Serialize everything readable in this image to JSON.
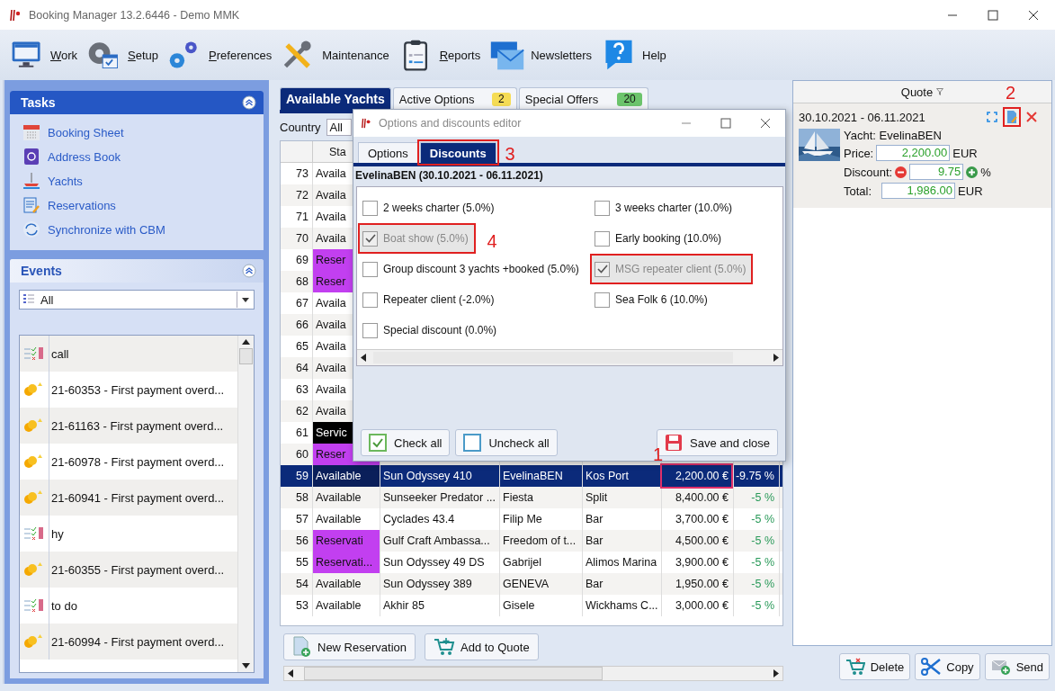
{
  "window": {
    "title": "Booking Manager 13.2.6446 - Demo MMK"
  },
  "toolbar": [
    {
      "label": "Work",
      "access_key": true
    },
    {
      "label": "Setup",
      "access_key": true
    },
    {
      "label": "Preferences",
      "access_key": true
    },
    {
      "label": "Maintenance",
      "access_key": false
    },
    {
      "label": "Reports",
      "access_key": true
    },
    {
      "label": "Newsletters",
      "access_key": false
    },
    {
      "label": "Help",
      "access_key": false
    }
  ],
  "tasks": {
    "title": "Tasks",
    "items": [
      "Booking Sheet",
      "Address Book",
      "Yachts",
      "Reservations",
      "Synchronize with CBM"
    ]
  },
  "events": {
    "title": "Events",
    "filter": "All",
    "items": [
      {
        "kind": "task",
        "text": "call"
      },
      {
        "kind": "payment",
        "text": "21-60353 - First payment overd..."
      },
      {
        "kind": "payment",
        "text": "21-61163 - First payment overd..."
      },
      {
        "kind": "payment",
        "text": "21-60978 - First payment overd..."
      },
      {
        "kind": "payment",
        "text": "21-60941 - First payment overd..."
      },
      {
        "kind": "task",
        "text": "hy"
      },
      {
        "kind": "payment",
        "text": "21-60355 - First payment overd..."
      },
      {
        "kind": "task",
        "text": "to do"
      },
      {
        "kind": "payment",
        "text": "21-60994 - First payment overd..."
      }
    ]
  },
  "tabs": [
    {
      "label": "Available Yachts",
      "selected": true
    },
    {
      "label": "Active Options",
      "selected": false,
      "badge": "2",
      "color": "#f5dc55"
    },
    {
      "label": "Special Offers",
      "selected": false,
      "badge": "20",
      "color": "#6cc46c"
    }
  ],
  "country": {
    "label": "Country",
    "value": "All"
  },
  "table": {
    "columns": [
      "Sta"
    ],
    "rows": [
      {
        "num": "73",
        "status": "Availa",
        "kind": "available",
        "selected": false
      },
      {
        "num": "72",
        "status": "Availa",
        "kind": "available",
        "selected": false
      },
      {
        "num": "71",
        "status": "Availa",
        "kind": "available",
        "selected": false
      },
      {
        "num": "70",
        "status": "Availa",
        "kind": "available",
        "selected": false
      },
      {
        "num": "69",
        "status": "Reser",
        "kind": "reservation",
        "selected": false
      },
      {
        "num": "68",
        "status": "Reser",
        "kind": "reservation",
        "selected": false
      },
      {
        "num": "67",
        "status": "Availa",
        "kind": "available",
        "selected": false
      },
      {
        "num": "66",
        "status": "Availa",
        "kind": "available",
        "selected": false
      },
      {
        "num": "65",
        "status": "Availa",
        "kind": "available",
        "selected": false
      },
      {
        "num": "64",
        "status": "Availa",
        "kind": "available",
        "selected": false
      },
      {
        "num": "63",
        "status": "Availa",
        "kind": "available",
        "selected": false
      },
      {
        "num": "62",
        "status": "Availa",
        "kind": "available",
        "selected": false
      },
      {
        "num": "61",
        "status": "Servic",
        "kind": "service",
        "selected": false
      },
      {
        "num": "60",
        "status": "Reser",
        "kind": "reservation",
        "selected": false
      },
      {
        "num": "59",
        "status": "Available",
        "kind": "available",
        "selected": true,
        "model": "Sun Odyssey 410",
        "name": "EvelinaBEN",
        "base": "Kos Port",
        "price": "2,200.00 €",
        "discount": "-9.75 %",
        "price_highlighted": true,
        "price_annotation": "1"
      },
      {
        "num": "58",
        "status": "Available",
        "kind": "available",
        "selected": false,
        "model": "Sunseeker Predator ...",
        "name": "Fiesta",
        "base": "Split",
        "price": "8,400.00 €",
        "discount": "-5 %"
      },
      {
        "num": "57",
        "status": "Available",
        "kind": "available",
        "selected": false,
        "model": "Cyclades 43.4",
        "name": "Filip Me",
        "base": "Bar",
        "price": "3,700.00 €",
        "discount": "-5 %"
      },
      {
        "num": "56",
        "status": "Reservati",
        "kind": "reservation",
        "selected": false,
        "model": "Gulf Craft Ambassa...",
        "name": "Freedom of t...",
        "base": "Bar",
        "price": "4,500.00 €",
        "discount": "-5 %"
      },
      {
        "num": "55",
        "status": "Reservati...",
        "kind": "reservation",
        "selected": false,
        "model": "Sun Odyssey 49 DS",
        "name": "Gabrijel",
        "base": "Alimos Marina",
        "price": "3,900.00 €",
        "discount": "-5 %"
      },
      {
        "num": "54",
        "status": "Available",
        "kind": "available",
        "selected": false,
        "model": "Sun Odyssey 389",
        "name": "GENEVA",
        "base": "Bar",
        "price": "1,950.00 €",
        "discount": "-5 %"
      },
      {
        "num": "53",
        "status": "Available",
        "kind": "available",
        "selected": false,
        "model": "Akhir 85",
        "name": "Gisele",
        "base": "Wickhams C...",
        "price": "3,000.00 €",
        "discount": "-5 %"
      }
    ]
  },
  "actions": [
    "New Reservation",
    "Add to Quote"
  ],
  "dialog": {
    "title": "Options and discounts editor",
    "tabs": [
      {
        "label": "Options",
        "selected": false,
        "highlighted": false
      },
      {
        "label": "Discounts",
        "selected": true,
        "highlighted": true,
        "annotation": "3"
      }
    ],
    "heading": "EvelinaBEN (30.10.2021 - 06.11.2021)",
    "discounts": [
      {
        "label": "2 weeks charter (5.0%)",
        "checked": false,
        "disabled": false,
        "highlighted": false
      },
      {
        "label": "3 weeks charter (10.0%)",
        "checked": false,
        "disabled": false,
        "highlighted": false
      },
      {
        "label": "Boat show  (5.0%)",
        "checked": true,
        "disabled": true,
        "highlighted": true,
        "annotation": "4"
      },
      {
        "label": "Early booking (10.0%)",
        "checked": false,
        "disabled": false,
        "highlighted": false
      },
      {
        "label": "Group discount 3 yachts +booked (5.0%)",
        "checked": false,
        "disabled": false,
        "highlighted": false
      },
      {
        "label": "MSG repeater client (5.0%)",
        "checked": true,
        "disabled": true,
        "highlighted": true
      },
      {
        "label": "Repeater client (-2.0%)",
        "checked": false,
        "disabled": false,
        "highlighted": false
      },
      {
        "label": "Sea Folk 6 (10.0%)",
        "checked": false,
        "disabled": false,
        "highlighted": false
      },
      {
        "label": "Special discount (0.0%)",
        "checked": false,
        "disabled": false,
        "highlighted": false
      }
    ],
    "buttons": [
      "Check all",
      "Uncheck all",
      "Save and close"
    ]
  },
  "quote": {
    "title": "Quote",
    "dates": "30.10.2021 - 06.11.2021",
    "edit_highlighted": true,
    "edit_annotation": "2",
    "yacht": "Yacht: EvelinaBEN",
    "price_label": "Price:",
    "price": "2,200.00",
    "price_unit": "EUR",
    "discount_label": "Discount:",
    "discount": "9.75",
    "discount_unit": "%",
    "total_label": "Total:",
    "total": "1,986.00",
    "total_unit": "EUR",
    "buttons": [
      "Delete",
      "Copy",
      "Send"
    ]
  }
}
